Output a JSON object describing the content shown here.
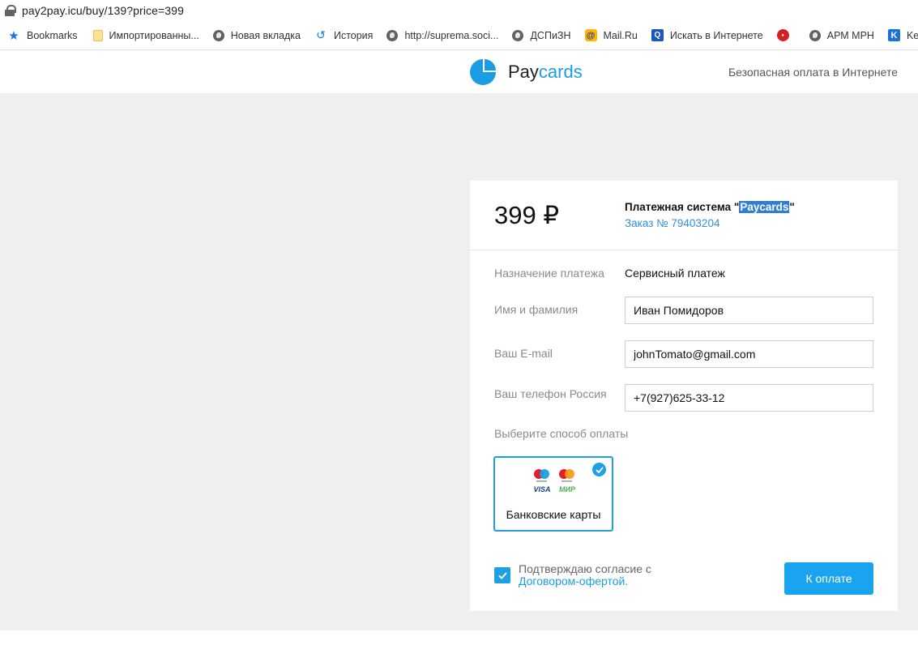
{
  "browser": {
    "url": "pay2pay.icu/buy/139?price=399",
    "bookmarks": [
      {
        "label": "Bookmarks",
        "icon": "star-icon"
      },
      {
        "label": "Импортированны...",
        "icon": "folder-icon"
      },
      {
        "label": "Новая вкладка",
        "icon": "globe-icon"
      },
      {
        "label": "История",
        "icon": "history-icon"
      },
      {
        "label": "http://suprema.soci...",
        "icon": "globe-icon"
      },
      {
        "label": "ДСПиЗН",
        "icon": "globe-icon"
      },
      {
        "label": "Mail.Ru",
        "icon": "mail-ru-icon"
      },
      {
        "label": "Искать в Интернете",
        "icon": "search-icon"
      },
      {
        "label": "",
        "icon": "red-circle-icon"
      },
      {
        "label": "АРМ МРН",
        "icon": "globe-icon"
      },
      {
        "label": "Keeneti",
        "icon": "keenetic-icon"
      }
    ]
  },
  "header": {
    "logo_pay": "Pay",
    "logo_cards": "cards",
    "tagline": "Безопасная оплата в Интернете",
    "brand_color": "#1a9de2"
  },
  "payment": {
    "amount": "399 ₽",
    "system_prefix": "Платежная система \"",
    "system_name": "Paycards",
    "system_suffix": "\"",
    "order": "Заказ № 79403204",
    "purpose_label": "Назначение платежа",
    "purpose_value": "Сервисный платеж",
    "name_label": "Имя и фамилия",
    "name_value": "Иван Помидоров",
    "email_label": "Ваш E-mail",
    "email_value": "johnTomato@gmail.com",
    "phone_label": "Ваш телефон Россия",
    "phone_value": "+7(927)625-33-12",
    "method_prompt": "Выберите способ оплаты",
    "method_label": "Банковские карты",
    "card_brands": [
      "VISA",
      "МИР"
    ],
    "agree_text": "Подтверждаю согласие с",
    "agree_link": "Договором-офертой.",
    "pay_button": "К оплате"
  }
}
